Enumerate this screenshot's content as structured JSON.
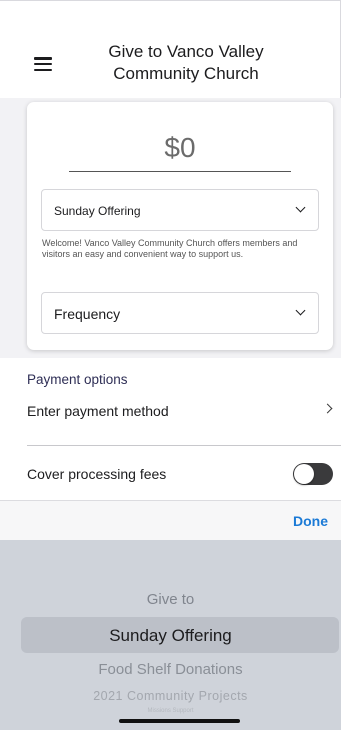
{
  "header": {
    "title": "Give to Vanco Valley Community Church",
    "menu_icon": "hamburger-menu-icon"
  },
  "donation_card": {
    "amount": "$0",
    "fund_select": {
      "value": "Sunday Offering",
      "icon": "chevron-down-icon"
    },
    "welcome_text": "Welcome! Vanco Valley Community Church offers members and visitors an easy and convenient way to support us.",
    "frequency_select": {
      "value": "Frequency",
      "icon": "chevron-down-icon"
    }
  },
  "payment": {
    "title": "Payment options",
    "method_label": "Enter payment method",
    "icon": "chevron-right-icon"
  },
  "fees": {
    "label": "Cover processing fees",
    "toggle_on": false
  },
  "picker_toolbar": {
    "done_label": "Done",
    "accent_color": "#1b7ad6"
  },
  "picker": {
    "options": [
      "Give to",
      "Sunday Offering",
      "Food Shelf Donations",
      "2021 Community Projects",
      "Missions Support"
    ],
    "selected": "Sunday Offering"
  }
}
